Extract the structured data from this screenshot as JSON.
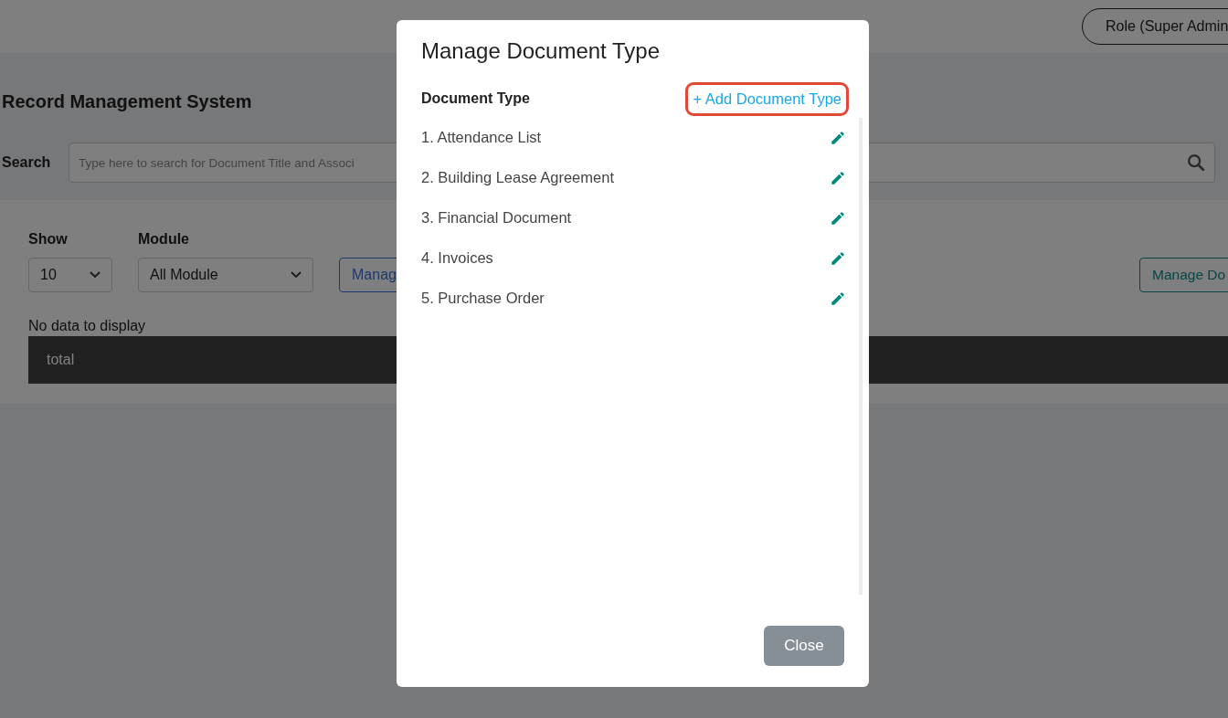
{
  "header": {
    "role_button": "Role (Super Admin"
  },
  "page": {
    "title": "Record Management System",
    "search": {
      "label": "Search",
      "placeholder": "Type here to search for Document Title and Associ"
    },
    "filters": [
      {
        "label": "Show",
        "value": "10"
      },
      {
        "label": "Module",
        "value": "All Module"
      }
    ],
    "buttons": [
      {
        "kind": "primary",
        "label": "Manag"
      },
      {
        "kind": "teal",
        "label": "Manage Do"
      }
    ],
    "empty_message": "No data to display",
    "total_label": "total"
  },
  "modal": {
    "title": "Manage Document Type",
    "list_heading": "Document Type",
    "add_link": "+ Add Document Type",
    "items": [
      "1. Attendance List",
      "2. Building Lease Agreement",
      "3. Financial Document",
      "4. Invoices",
      "5. Purchase Order"
    ],
    "close_button": "Close"
  }
}
